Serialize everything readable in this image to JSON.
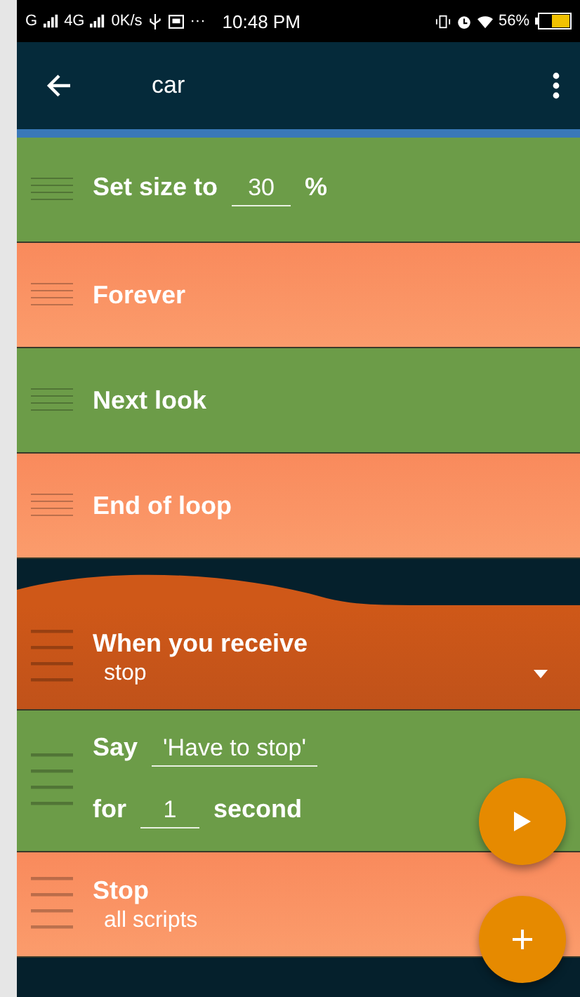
{
  "status_bar": {
    "network_1": "G",
    "network_2": "4G",
    "speed": "0K/s",
    "more": "···",
    "time": "10:48 PM",
    "battery": "56%"
  },
  "app_bar": {
    "title": "car"
  },
  "blocks": [
    {
      "kind": "looks",
      "lines": [
        [
          {
            "kind": "label",
            "text": "Set size to"
          },
          {
            "kind": "field",
            "text": "30"
          },
          {
            "kind": "label",
            "text": "%"
          }
        ]
      ]
    },
    {
      "kind": "control",
      "lines": [
        [
          {
            "kind": "label",
            "text": "Forever"
          }
        ]
      ]
    },
    {
      "kind": "looks",
      "lines": [
        [
          {
            "kind": "label",
            "text": "Next look"
          }
        ]
      ]
    },
    {
      "kind": "control",
      "lines": [
        [
          {
            "kind": "label",
            "text": "End of loop"
          }
        ]
      ]
    },
    {
      "kind": "event",
      "lines": [
        [
          {
            "kind": "label",
            "text": "When you receive"
          }
        ],
        [
          {
            "kind": "select",
            "text": "stop"
          }
        ]
      ]
    },
    {
      "kind": "looks",
      "lines": [
        [
          {
            "kind": "label",
            "text": "Say"
          },
          {
            "kind": "field",
            "text": "'Have to stop'"
          }
        ],
        [
          {
            "kind": "label",
            "text": "for"
          },
          {
            "kind": "field",
            "text": "1"
          },
          {
            "kind": "label",
            "text": "second"
          }
        ]
      ]
    },
    {
      "kind": "control",
      "lines": [
        [
          {
            "kind": "label",
            "text": "Stop"
          }
        ],
        [
          {
            "kind": "value",
            "text": "all scripts"
          }
        ]
      ]
    }
  ]
}
